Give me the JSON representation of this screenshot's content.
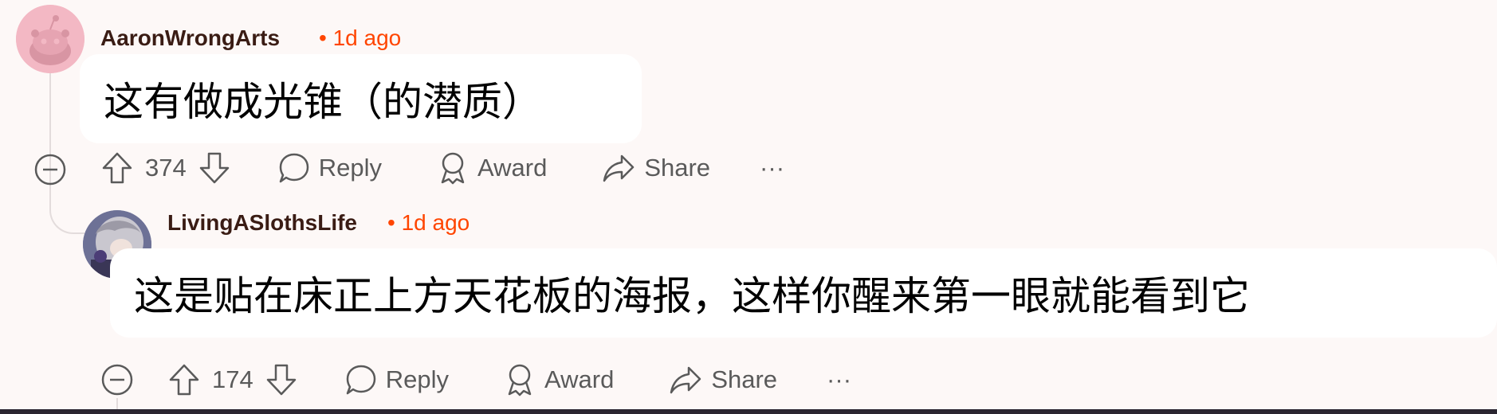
{
  "comments": [
    {
      "username": "AaronWrongArts",
      "time": "• 1d ago",
      "body": "这有做成光锥（的潜质）",
      "votes": "374",
      "actions": {
        "reply": "Reply",
        "award": "Award",
        "share": "Share",
        "more": "···"
      },
      "avatar_icon": "reddit-snoo-avatar",
      "avatar_color": "#f3b8c4"
    },
    {
      "username": "LivingASlothsLife",
      "time": "• 1d ago",
      "body": "这是贴在床正上方天花板的海报，这样你醒来第一眼就能看到它",
      "votes": "174",
      "actions": {
        "reply": "Reply",
        "award": "Award",
        "share": "Share",
        "more": "···"
      },
      "avatar_icon": "anime-character-avatar"
    }
  ],
  "colors": {
    "accent": "#ff4500",
    "username": "#3a1c14",
    "thread_line": "#e3dcdc"
  }
}
